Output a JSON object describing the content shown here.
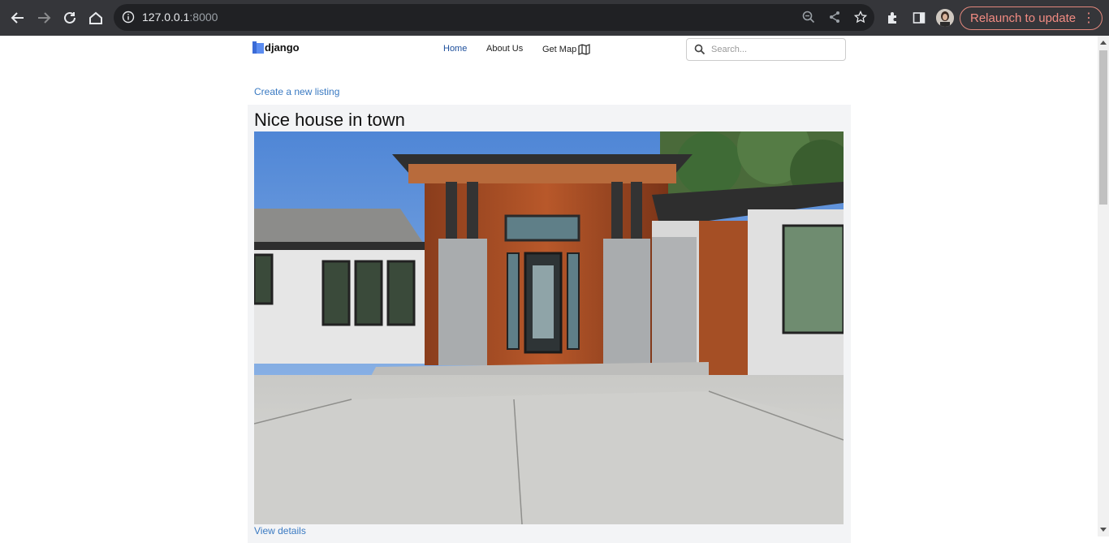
{
  "browser": {
    "url_host": "127.0.0.1",
    "url_port": ":8000",
    "relaunch_label": "Relaunch to update",
    "relaunch_color": "#f28b82"
  },
  "site": {
    "logo_text": "django",
    "nav": {
      "home": "Home",
      "about": "About Us",
      "map": "Get Map"
    },
    "search_placeholder": "Search...",
    "create_link": "Create a new listing"
  },
  "listing": {
    "title": "Nice house in town",
    "link_label": "View details"
  },
  "colors": {
    "accent_link": "#3a7ac2",
    "active_nav": "#1d4f9c"
  }
}
